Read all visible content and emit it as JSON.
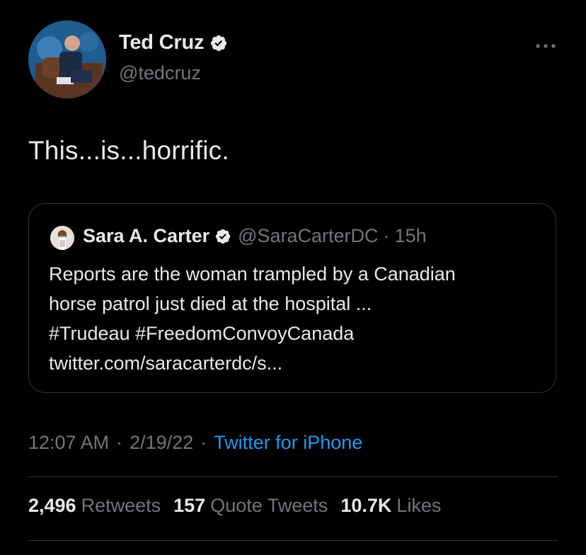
{
  "author": {
    "name": "Ted Cruz",
    "handle": "@tedcruz",
    "verified_icon": "verified-badge-icon"
  },
  "tweet": {
    "text": "This...is...horrific."
  },
  "quoted_tweet": {
    "name": "Sara A. Carter",
    "handle": "@SaraCarterDC",
    "separator": "·",
    "time": "15h",
    "body_lines": [
      "Reports are the woman trampled by a Canadian",
      "horse patrol just died at the hospital ...",
      "#Trudeau #FreedomConvoyCanada",
      "twitter.com/saracarterdc/s..."
    ]
  },
  "meta": {
    "time": "12:07 AM",
    "sep1": "·",
    "date": "2/19/22",
    "sep2": "·",
    "source": "Twitter for iPhone"
  },
  "stats": {
    "retweets_count": "2,496",
    "retweets_label": "Retweets",
    "quotes_count": "157",
    "quotes_label": "Quote Tweets",
    "likes_count": "10.7K",
    "likes_label": "Likes"
  },
  "colors": {
    "background": "#000000",
    "text_primary": "#e7e9ea",
    "text_secondary": "#71767b",
    "link": "#1d9bf0",
    "border": "#2f3336"
  }
}
